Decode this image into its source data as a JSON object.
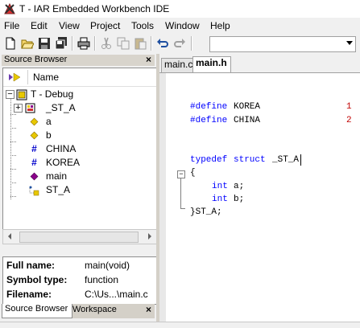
{
  "window": {
    "title": "T - IAR Embedded Workbench IDE"
  },
  "menu": [
    "File",
    "Edit",
    "View",
    "Project",
    "Tools",
    "Window",
    "Help"
  ],
  "toolbar": {
    "icons": [
      "new-file",
      "open",
      "save",
      "save-all",
      "print",
      "cut",
      "copy",
      "paste",
      "undo",
      "redo"
    ],
    "combo_value": ""
  },
  "source_browser": {
    "title": "Source Browser",
    "column_name": "Name",
    "tree": [
      {
        "label": "T - Debug",
        "icon": "project-icon",
        "expander": "minus"
      },
      {
        "label": "_ST_A",
        "icon": "struct-icon",
        "expander": "plus"
      },
      {
        "label": "a",
        "icon": "variable-diamond-icon",
        "expander": ""
      },
      {
        "label": "b",
        "icon": "variable-diamond-icon",
        "expander": ""
      },
      {
        "label": "CHINA",
        "icon": "macro-hash-icon",
        "expander": ""
      },
      {
        "label": "KOREA",
        "icon": "macro-hash-icon",
        "expander": ""
      },
      {
        "label": "main",
        "icon": "function-diamond-icon",
        "expander": ""
      },
      {
        "label": "ST_A",
        "icon": "typedef-icon",
        "expander": ""
      }
    ],
    "info": {
      "full_name_label": "Full name:",
      "full_name": "main(void)",
      "symbol_type_label": "Symbol type:",
      "symbol_type": "function",
      "filename_label": "Filename:",
      "filename": "C:\\Us...\\main.c"
    },
    "tabs": [
      "Source Browser",
      "Workspace"
    ]
  },
  "editor": {
    "tabs": [
      {
        "label": "main.c",
        "active": false
      },
      {
        "label": "main.h",
        "active": true
      }
    ],
    "code": {
      "define1_kw": "#define",
      "define1_name": "KOREA",
      "define1_val": "1",
      "define2_kw": "#define",
      "define2_name": "CHINA",
      "define2_val": "2",
      "typedef_kw1": "typedef",
      "typedef_kw2": "struct",
      "typedef_name": "_ST_A",
      "open_brace": "{",
      "member1_kw": "int",
      "member1": "a;",
      "member2_kw": "int",
      "member2": "b;",
      "close": "}ST_A;"
    }
  },
  "colors": {
    "keyword": "#0000ff",
    "number": "#c00000",
    "macro_icon": "#0000cc",
    "variable_icon": "#e8c800",
    "function_icon": "#8b008b"
  }
}
